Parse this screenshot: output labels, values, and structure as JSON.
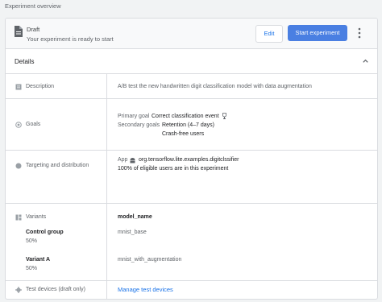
{
  "overview_title": "Experiment overview",
  "status": {
    "label": "Draft",
    "subtitle": "Your experiment is ready to start",
    "edit_label": "Edit",
    "start_label": "Start experiment"
  },
  "details": {
    "title": "Details",
    "description_label": "Description",
    "description_value": "A/B test the new handwritten digit classification model with data augmentation",
    "goals_label": "Goals",
    "primary_goal_label": "Primary goal",
    "primary_goal_value": "Correct classification event",
    "secondary_goals_label": "Secondary goals",
    "secondary_goals": [
      "Retention (4–7 days)",
      "Crash-free users"
    ],
    "targeting_label": "Targeting and distribution",
    "app_label": "App",
    "app_value": "org.tensorflow.lite.examples.digitclssifier",
    "distribution_text": "100% of eligible users are in this experiment",
    "variants_label": "Variants",
    "variant_param_name": "model_name",
    "variants": [
      {
        "name": "Control group",
        "percent": "50%",
        "value": "mnist_base"
      },
      {
        "name": "Variant A",
        "percent": "50%",
        "value": "mnist_with_augmentation"
      }
    ],
    "test_devices_label": "Test devices (draft only)",
    "manage_test_devices_label": "Manage test devices"
  },
  "colors": {
    "accent": "#1a73e8",
    "primary_button": "#4a7fe2"
  }
}
